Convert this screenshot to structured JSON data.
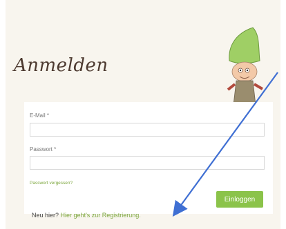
{
  "page": {
    "title": "Anmelden"
  },
  "form": {
    "email_label": "E-Mail *",
    "password_label": "Passwort *",
    "forgot_link": "Passwort vergessen?",
    "login_button": "Einloggen"
  },
  "footer": {
    "new_here": "Neu hier?",
    "register_link": "Hier geht's zur Registrierung."
  },
  "colors": {
    "accent_green": "#8bc34a",
    "link_green": "#7aa53a",
    "annotation_arrow": "#3f6fd3"
  },
  "icons": {
    "mascot": "gnome-illustration",
    "annotation": "arrow-annotation"
  }
}
